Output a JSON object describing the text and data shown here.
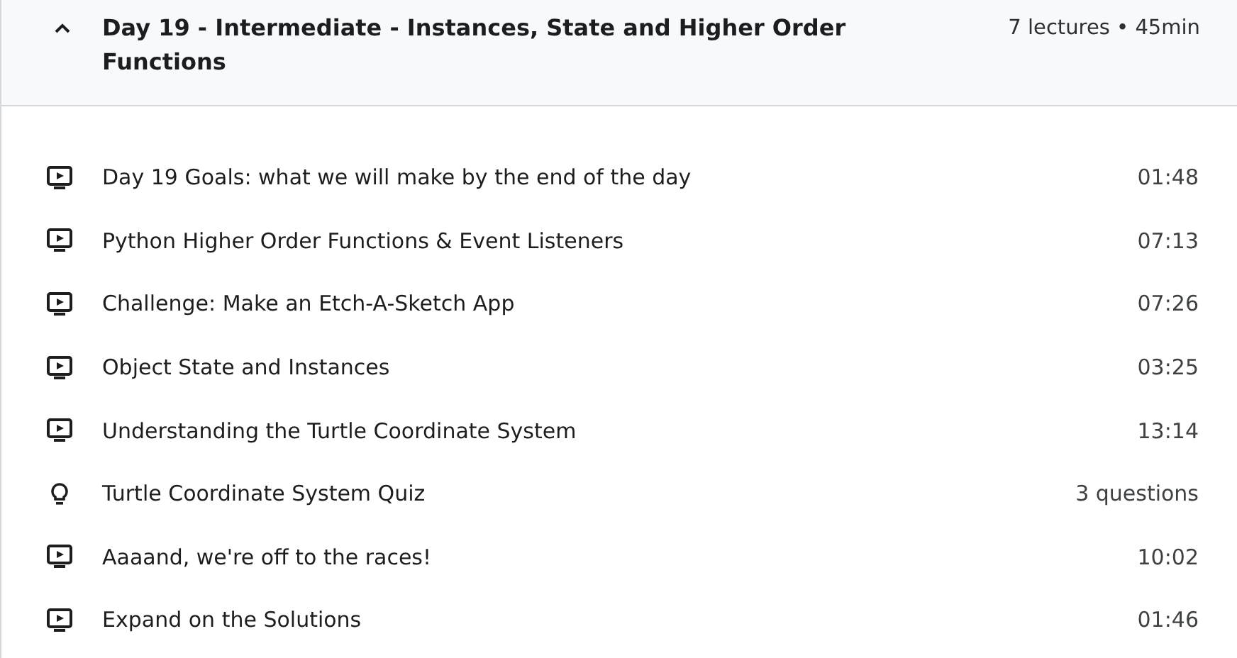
{
  "section": {
    "title": "Day 19 - Intermediate - Instances, State and Higher Order Functions",
    "meta": "7 lectures • 45min",
    "expanded": true
  },
  "items": [
    {
      "kind": "video",
      "title": "Day 19 Goals: what we will make by the end of the day",
      "duration": "01:48"
    },
    {
      "kind": "video",
      "title": "Python Higher Order Functions & Event Listeners",
      "duration": "07:13"
    },
    {
      "kind": "video",
      "title": "Challenge: Make an Etch-A-Sketch App",
      "duration": "07:26"
    },
    {
      "kind": "video",
      "title": "Object State and Instances",
      "duration": "03:25"
    },
    {
      "kind": "video",
      "title": "Understanding the Turtle Coordinate System",
      "duration": "13:14"
    },
    {
      "kind": "quiz",
      "title": "Turtle Coordinate System Quiz",
      "duration": "3 questions"
    },
    {
      "kind": "video",
      "title": "Aaaand, we're off to the races!",
      "duration": "10:02"
    },
    {
      "kind": "video",
      "title": "Expand on the Solutions",
      "duration": "01:46"
    }
  ]
}
